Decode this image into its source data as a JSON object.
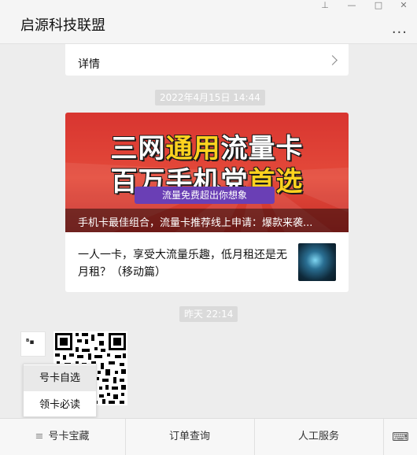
{
  "window": {
    "title": "启源科技联盟",
    "controls": [
      "pin-icon",
      "minimize-icon",
      "maximize-icon",
      "close-icon"
    ],
    "more_label": "..."
  },
  "detail_card": {
    "label": "详情"
  },
  "timestamps": {
    "first": "2022年4月15日 14:44",
    "second": "昨天 22:14"
  },
  "article": {
    "banner_line1_a": "三网",
    "banner_line1_b": "通用",
    "banner_line1_c": "流量卡",
    "banner_line2_a": "百万手机党",
    "banner_line2_b": "首选",
    "banner_ribbon": "流量免费超出你想象",
    "main_title": "手机卡最佳组合，流量卡推荐线上申请：爆款来袭...",
    "sub_title": "一人一卡，享受大流量乐趣，低月租还是无月租？（移动篇）"
  },
  "popup_menu": {
    "items": [
      "号卡自选",
      "领卡必读"
    ]
  },
  "bottom_menu": {
    "items": [
      "号卡宝藏",
      "订单查询",
      "人工服务"
    ],
    "menu_icon": "menu-icon",
    "keyboard_icon": "keyboard-icon"
  },
  "colors": {
    "accent": "#d83530",
    "highlight": "#ffd21f",
    "ribbon": "#6a3fb5"
  }
}
